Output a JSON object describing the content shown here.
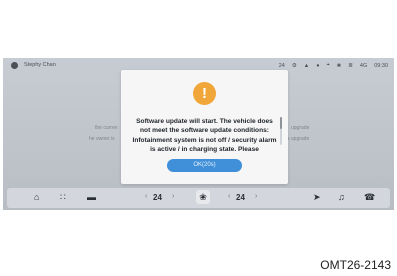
{
  "status_bar": {
    "user_name": "Stephy Chan",
    "items": [
      "24",
      "⚙",
      "▲",
      "●",
      "⌖",
      "❀",
      "≣",
      "4G",
      "09:30"
    ]
  },
  "background": {
    "left_line_1": "the curren",
    "left_line_2": "he owner is",
    "right_line_1": "upgrade",
    "right_line_2": "s upgrade"
  },
  "dialog": {
    "icon": "warning-icon",
    "message": "Software update will start. The vehicle does not meet the software update conditions: Infotainment system is not off / security alarm is active / in charging state. Please",
    "ok_label": "OK(20s)"
  },
  "bottom_bar": {
    "home_icon": "⌂",
    "apps_icon": "∷",
    "car_icon": "▬",
    "temp_left": "24",
    "temp_right": "24",
    "chevron_left": "‹",
    "chevron_right": "›",
    "fan_icon": "❀",
    "nav_icon": "➤",
    "music_icon": "♫",
    "phone_icon": "☎"
  },
  "caption": "OMT26-2143",
  "colors": {
    "accent": "#3f8fd9",
    "warning": "#f1a63a"
  }
}
